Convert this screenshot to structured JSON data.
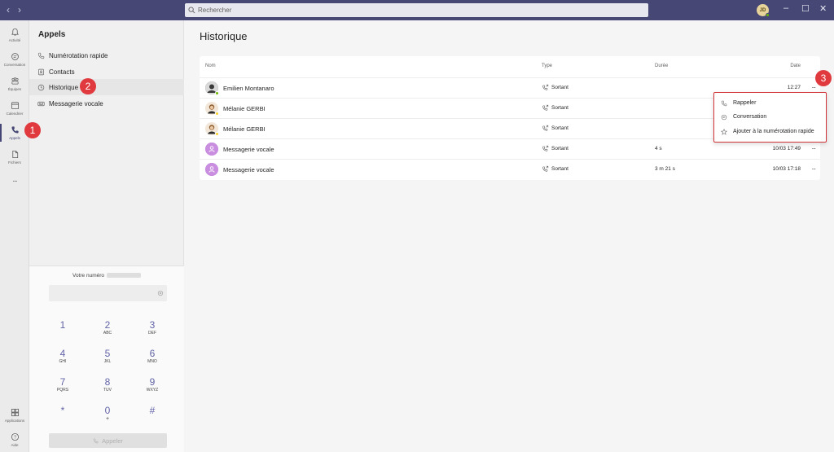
{
  "titlebar": {
    "back": "‹",
    "forward": "›",
    "search_placeholder": "Rechercher",
    "avatar_initials": "JD"
  },
  "rail": {
    "items": [
      {
        "label": "Activité",
        "icon": "bell-icon"
      },
      {
        "label": "Conversation",
        "icon": "chat-icon"
      },
      {
        "label": "Équipes",
        "icon": "teams-icon"
      },
      {
        "label": "Calendrier",
        "icon": "calendar-icon"
      },
      {
        "label": "Appels",
        "icon": "phone-icon"
      },
      {
        "label": "Fichiers",
        "icon": "file-icon"
      },
      {
        "label": "...",
        "icon": "more-icon"
      }
    ],
    "bottom": [
      {
        "label": "Applications",
        "icon": "apps-icon"
      },
      {
        "label": "Aide",
        "icon": "help-icon"
      }
    ]
  },
  "pane": {
    "title": "Appels",
    "items": [
      {
        "label": "Numérotation rapide",
        "icon": "phone-icon"
      },
      {
        "label": "Contacts",
        "icon": "contacts-icon"
      },
      {
        "label": "Historique",
        "icon": "clock-icon"
      },
      {
        "label": "Messagerie vocale",
        "icon": "voicemail-icon"
      }
    ]
  },
  "dialpad": {
    "your_number_label": "Votre numéro",
    "keys": [
      {
        "d": "1",
        "l": ""
      },
      {
        "d": "2",
        "l": "ABC"
      },
      {
        "d": "3",
        "l": "DEF"
      },
      {
        "d": "4",
        "l": "GHI"
      },
      {
        "d": "5",
        "l": "JKL"
      },
      {
        "d": "6",
        "l": "MNO"
      },
      {
        "d": "7",
        "l": "PQRS"
      },
      {
        "d": "8",
        "l": "TUV"
      },
      {
        "d": "9",
        "l": "WXYZ"
      },
      {
        "d": "*",
        "l": ""
      },
      {
        "d": "0",
        "l": "+"
      },
      {
        "d": "#",
        "l": ""
      }
    ],
    "call_label": "Appeler"
  },
  "main": {
    "title": "Historique",
    "columns": {
      "name": "Nom",
      "type": "Type",
      "duration": "Durée",
      "date": "Date"
    },
    "rows": [
      {
        "name": "Emilien Montanaro",
        "type": "Sortant",
        "duration": "",
        "date": "12:27",
        "avatar": "photo",
        "status": "#6bb700"
      },
      {
        "name": "Mélanie GERBI",
        "type": "Sortant",
        "duration": "",
        "date": "",
        "avatar": "photo",
        "status": "#f8d22a"
      },
      {
        "name": "Mélanie GERBI",
        "type": "Sortant",
        "duration": "",
        "date": "",
        "avatar": "photo",
        "status": "#f8d22a"
      },
      {
        "name": "Messagerie vocale",
        "type": "Sortant",
        "duration": "4 s",
        "date": "10/03 17:49",
        "avatar": "voicemail",
        "status": ""
      },
      {
        "name": "Messagerie vocale",
        "type": "Sortant",
        "duration": "3 m 21 s",
        "date": "10/03 17:18",
        "avatar": "voicemail",
        "status": ""
      }
    ],
    "more_label": "..."
  },
  "context_menu": {
    "items": [
      {
        "label": "Rappeler",
        "icon": "phone-icon"
      },
      {
        "label": "Conversation",
        "icon": "chat-icon"
      },
      {
        "label": "Ajouter à la numérotation rapide",
        "icon": "star-icon"
      }
    ]
  },
  "badges": [
    "1",
    "2",
    "3"
  ],
  "colors": {
    "brand": "#464775",
    "accent": "#6264a7",
    "badge": "#e03a3e"
  }
}
